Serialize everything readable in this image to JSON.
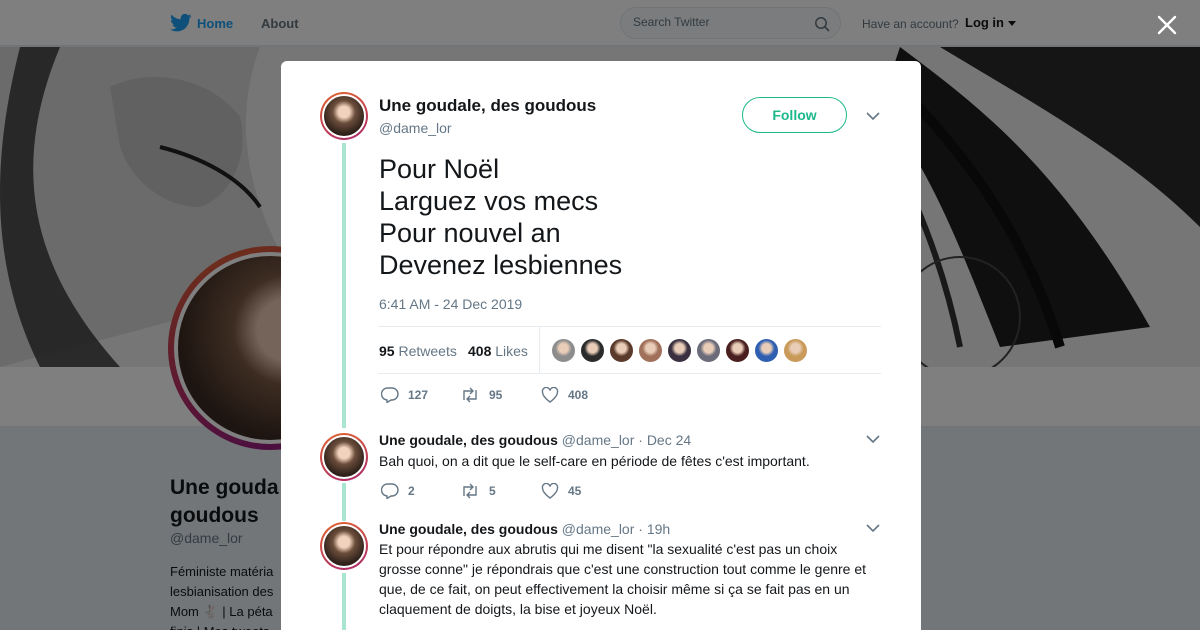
{
  "nav": {
    "home_label": "Home",
    "about_label": "About",
    "search_placeholder": "Search Twitter",
    "have_account": "Have an account?",
    "login_label": "Log in"
  },
  "profile": {
    "name_line1": "Une gouda",
    "name_line2": "goudous",
    "handle": "@dame_lor",
    "bio_lines": [
      "Féministe matéria",
      "lesbianisation des",
      "Mom 🐇 | La péta",
      "finis | Mes tweets"
    ]
  },
  "tweet": {
    "author_name": "Une goudale, des goudous",
    "author_handle": "@dame_lor",
    "follow_label": "Follow",
    "text_lines": [
      "Pour Noël",
      "Larguez vos mecs",
      "Pour nouvel an",
      "Devenez lesbiennes"
    ],
    "timestamp": "6:41 AM - 24 Dec 2019",
    "retweets_count": "95",
    "retweets_label": "Retweets",
    "likes_count": "408",
    "likes_label": "Likes",
    "actions": {
      "replies": "127",
      "retweets": "95",
      "likes": "408"
    },
    "liker_colors": [
      "#8d8d8d",
      "#2b2b2b",
      "#5a3a2a",
      "#a0705a",
      "#3a3040",
      "#6b6b7a",
      "#4a1f1f",
      "#2f5fb0",
      "#c99a5a"
    ]
  },
  "replies": [
    {
      "author_name": "Une goudale, des goudous",
      "author_handle": "@dame_lor",
      "time": "· Dec 24",
      "text_lines": [
        "Bah quoi, on a dit que le self-care en période de fêtes c'est important."
      ],
      "replies": "2",
      "retweets": "5",
      "likes": "45"
    },
    {
      "author_name": "Une goudale, des goudous",
      "author_handle": "@dame_lor",
      "time": "· 19h",
      "text_lines": [
        "Et pour répondre aux abrutis qui me disent \"la sexualité c'est pas un choix",
        "grosse conne\" je répondrais que c'est une construction tout comme le genre et",
        "que, de ce fait, on peut effectivement la choisir même si ça se fait pas en un",
        "claquement de doigts, la bise et joyeux Noël."
      ]
    }
  ],
  "colors": {
    "accent": "#1da1f2",
    "follow": "#1db88a",
    "thread_line": "#a8e6cf"
  }
}
